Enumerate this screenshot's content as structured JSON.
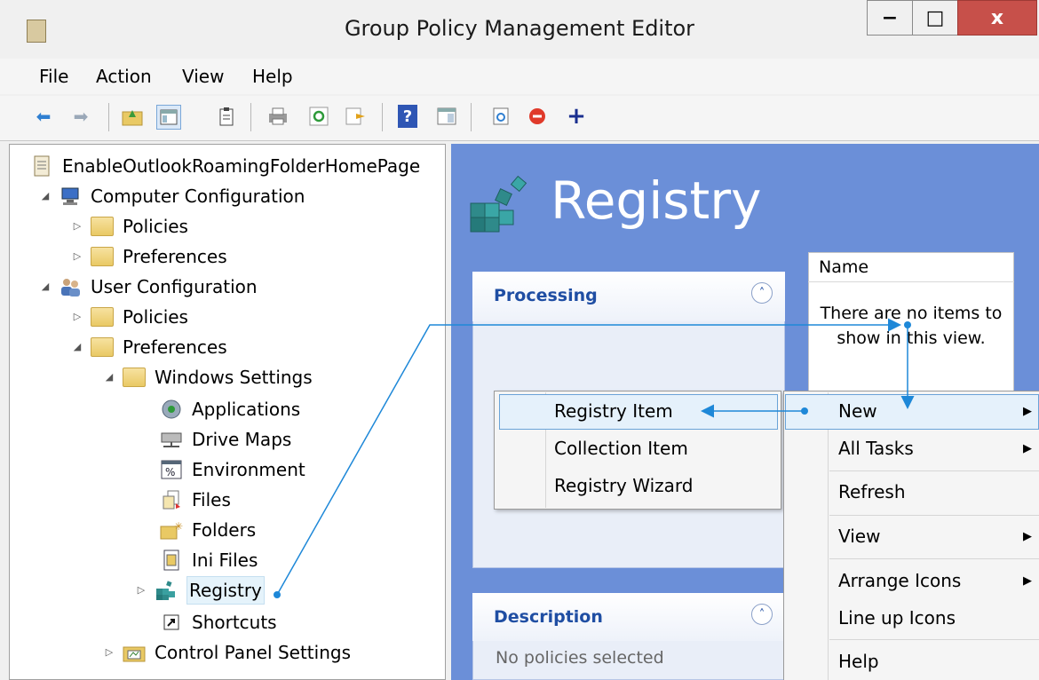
{
  "window": {
    "title": "Group Policy Management Editor",
    "minimize": "−",
    "maximize": "□",
    "close": "x"
  },
  "menu": [
    "File",
    "Action",
    "View",
    "Help"
  ],
  "tree": {
    "root": "EnableOutlookRoamingFolderHomePage",
    "computer_configuration": "Computer Configuration",
    "cc_policies": "Policies",
    "cc_preferences": "Preferences",
    "user_configuration": "User Configuration",
    "uc_policies": "Policies",
    "uc_preferences": "Preferences",
    "windows_settings": "Windows Settings",
    "applications": "Applications",
    "drive_maps": "Drive Maps",
    "environment": "Environment",
    "files": "Files",
    "folders": "Folders",
    "ini_files": "Ini Files",
    "registry": "Registry",
    "shortcuts": "Shortcuts",
    "control_panel_settings": "Control Panel Settings"
  },
  "main": {
    "title": "Registry",
    "processing_label": "Processing",
    "description_label": "Description",
    "description_text": "No policies selected",
    "list_header": "Name",
    "empty_line1": "There are no items to",
    "empty_line2": "show in this view."
  },
  "submenu": [
    "Registry Item",
    "Collection Item",
    "Registry Wizard"
  ],
  "context_menu": [
    "New",
    "All Tasks",
    "Refresh",
    "View",
    "Arrange Icons",
    "Line up Icons",
    "Help"
  ],
  "colors": {
    "pane_blue": "#6b8fd8",
    "annotation": "#1e88d8",
    "close_red": "#c7504a"
  }
}
